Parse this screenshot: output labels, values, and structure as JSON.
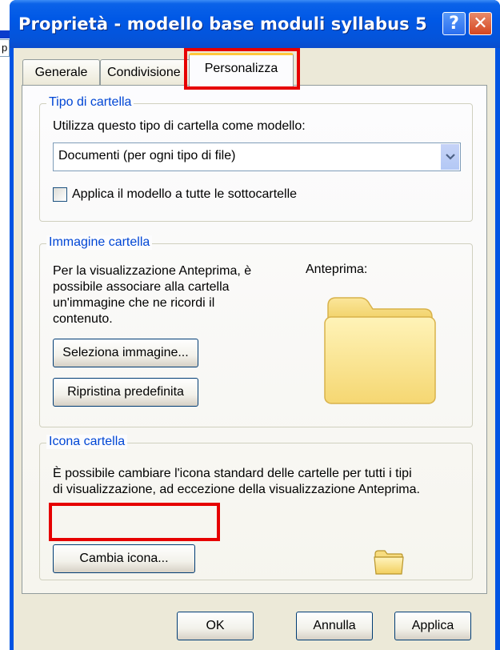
{
  "background": {
    "partial_text": "p"
  },
  "dialog": {
    "title": "Proprietà - modello base moduli syllabus 5",
    "help_glyph": "?",
    "close_glyph": "✕"
  },
  "tabs": [
    {
      "label": "Generale"
    },
    {
      "label": "Condivisione"
    },
    {
      "label": "Personalizza",
      "active": true
    }
  ],
  "folder_type_group": {
    "legend": "Tipo di cartella",
    "prompt": "Utilizza questo tipo di cartella come modello:",
    "select_value": "Documenti (per ogni tipo di file)",
    "checkbox_label": "Applica il modello a tutte le sottocartelle",
    "checkbox_checked": false
  },
  "folder_image_group": {
    "legend": "Immagine cartella",
    "desc_lines": [
      "Per la visualizzazione Anteprima, è",
      "possibile associare alla cartella",
      "un'immagine che ne ricordi il",
      "contenuto."
    ],
    "preview_label": "Anteprima:",
    "select_image_button": "Seleziona immagine...",
    "restore_button": "Ripristina predefinita"
  },
  "folder_icon_group": {
    "legend": "Icona cartella",
    "desc_lines": [
      "È possibile cambiare l'icona standard delle cartelle per tutti i tipi",
      "di visualizzazione, ad eccezione della visualizzazione Anteprima."
    ],
    "change_icon_button": "Cambia icona..."
  },
  "footer": {
    "ok": "OK",
    "cancel": "Annulla",
    "apply": "Applica"
  },
  "colors": {
    "title_blue": "#0054e3",
    "legend_blue": "#0046d5",
    "highlight_red": "#e60000",
    "client_bg": "#ece9d8"
  }
}
